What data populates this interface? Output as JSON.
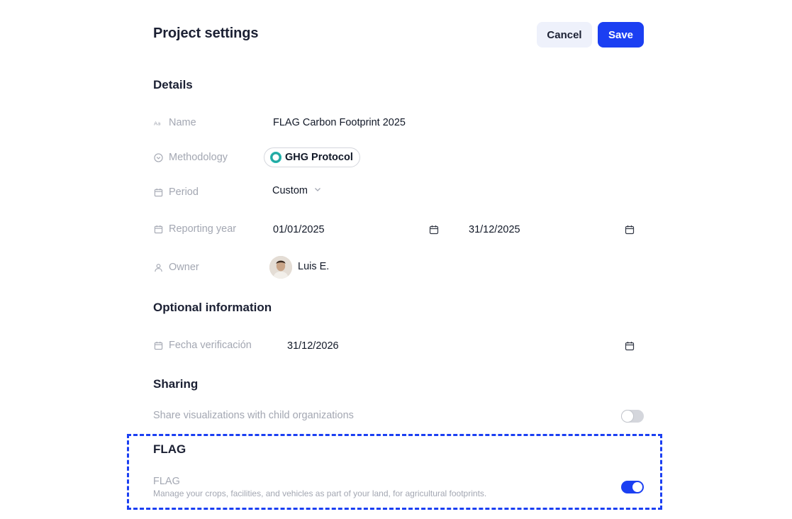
{
  "header": {
    "title": "Project settings",
    "cancel_label": "Cancel",
    "save_label": "Save"
  },
  "details": {
    "section_title": "Details",
    "name": {
      "label": "Name",
      "value": "FLAG Carbon Footprint 2025",
      "icon": "text-format-icon"
    },
    "methodology": {
      "label": "Methodology",
      "value": "GHG Protocol",
      "icon": "chevron-circle-icon"
    },
    "period": {
      "label": "Period",
      "value": "Custom",
      "icon": "calendar-icon"
    },
    "reporting_year": {
      "label": "Reporting year",
      "start": "01/01/2025",
      "end": "31/12/2025",
      "icon": "calendar-icon"
    },
    "owner": {
      "label": "Owner",
      "name": "Luis E.",
      "icon": "user-icon"
    }
  },
  "optional": {
    "section_title": "Optional information",
    "verification_date": {
      "label": "Fecha verificación",
      "value": "31/12/2026",
      "icon": "calendar-icon"
    }
  },
  "sharing": {
    "section_title": "Sharing",
    "share_label": "Share visualizations with child organizations",
    "enabled": false
  },
  "flag": {
    "section_title": "FLAG",
    "item_title": "FLAG",
    "item_description": "Manage your crops, facilities, and vehicles as part of your land, for agricultural footprints.",
    "enabled": true
  },
  "colors": {
    "primary": "#1b3ff2",
    "muted_text": "#a3a7b2",
    "cancel_bg": "#eef1fb",
    "chip_accent": "#21a5a0"
  }
}
